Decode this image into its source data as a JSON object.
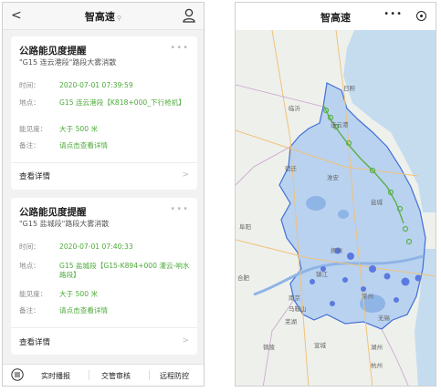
{
  "left": {
    "nav": {
      "back": "<",
      "title": "智高速",
      "title_mark": "⚲"
    },
    "cards": [
      {
        "title": "公路能见度提醒",
        "subtitle": "\"G15 连云港段\"路段大雾消散",
        "time_label": "时间：",
        "time_value": "2020-07-01 07:39:59",
        "place_label": "地点：",
        "place_value": "G15 连云港段【K818+000_下行枪机】",
        "vis_label": "能见度：",
        "vis_value": "大于 500 米",
        "note_label": "备注：",
        "note_value": "请点击查看详情",
        "detail": "查看详情"
      },
      {
        "title": "公路能见度提醒",
        "subtitle": "\"G15 盐城段\"路段大雾消散",
        "time_label": "时间：",
        "time_value": "2020-07-01 07:40:33",
        "place_label": "地点：",
        "place_value": "G15 盐城段【G15-K894+000 灌云-响水路段】",
        "vis_label": "能见度：",
        "vis_value": "大于 500 米",
        "note_label": "备注：",
        "note_value": "请点击查看详情",
        "detail": "查看详情"
      }
    ],
    "more": "•••",
    "chevron": ">",
    "tabs": [
      "实时播报",
      "交管审核",
      "远程防控"
    ]
  },
  "right": {
    "nav": {
      "title": "智高速",
      "dots": "•••"
    },
    "map_labels": [
      {
        "text": "日照"
      },
      {
        "text": "临沂"
      },
      {
        "text": "连云港"
      },
      {
        "text": "宿迁"
      },
      {
        "text": "淮安"
      },
      {
        "text": "盐城"
      },
      {
        "text": "阜阳"
      },
      {
        "text": "合肥"
      },
      {
        "text": "南京"
      },
      {
        "text": "扬州"
      },
      {
        "text": "镇江"
      },
      {
        "text": "常州"
      },
      {
        "text": "马鞍山"
      },
      {
        "text": "芜湖"
      },
      {
        "text": "无锡"
      },
      {
        "text": "宣城"
      },
      {
        "text": "湖州"
      },
      {
        "text": "铜陵"
      },
      {
        "text": "杭州"
      }
    ],
    "colors": {
      "province_fill": "#b9d2f0",
      "province_border": "#3f6fd6",
      "road_marker": "#5cb04a",
      "alert_marker": "#5a7ae0"
    }
  }
}
